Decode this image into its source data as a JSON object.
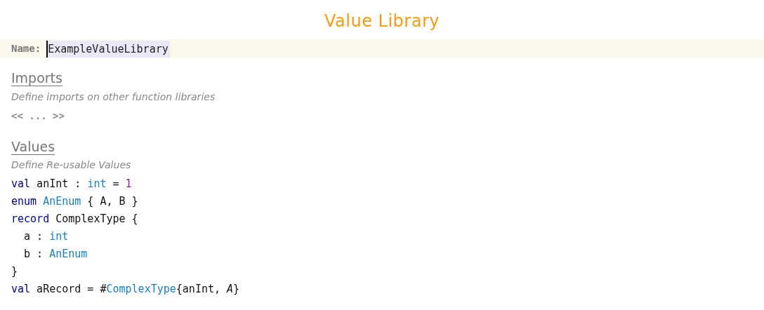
{
  "title": "Value Library",
  "name_field": {
    "label": "Name:",
    "value": "ExampleValueLibrary"
  },
  "sections": [
    {
      "heading": "Imports",
      "description": "Define imports on other function libraries",
      "placeholder_text": "<< ... >>"
    },
    {
      "heading": "Values",
      "description": "Define Re-usable Values",
      "code": [
        {
          "tokens": [
            {
              "kind": "keyword",
              "text": "val"
            },
            {
              "kind": "plain",
              "text": " anInt : "
            },
            {
              "kind": "type",
              "text": "int"
            },
            {
              "kind": "plain",
              "text": " = "
            },
            {
              "kind": "number",
              "text": "1"
            }
          ]
        },
        {
          "tokens": [
            {
              "kind": "keyword",
              "text": "enum"
            },
            {
              "kind": "type",
              "text": " AnEnum"
            },
            {
              "kind": "plain",
              "text": " { A, B }"
            }
          ]
        },
        {
          "tokens": [
            {
              "kind": "keyword",
              "text": "record"
            },
            {
              "kind": "plain",
              "text": " ComplexType {"
            }
          ],
          "children": [
            {
              "tokens": [
                {
                  "kind": "plain",
                  "text": "a : "
                },
                {
                  "kind": "type",
                  "text": "int"
                }
              ]
            },
            {
              "tokens": [
                {
                  "kind": "plain",
                  "text": "b : "
                },
                {
                  "kind": "type",
                  "text": "AnEnum"
                }
              ]
            }
          ]
        },
        {
          "tokens": [
            {
              "kind": "plain",
              "text": "}"
            }
          ]
        },
        {
          "tokens": [
            {
              "kind": "keyword",
              "text": "val"
            },
            {
              "kind": "plain",
              "text": " aRecord = #"
            },
            {
              "kind": "type",
              "text": "ComplexType"
            },
            {
              "kind": "plain",
              "text": "{anInt, "
            },
            {
              "kind": "literal",
              "text": "A"
            },
            {
              "kind": "plain",
              "text": "}"
            }
          ]
        }
      ]
    }
  ]
}
